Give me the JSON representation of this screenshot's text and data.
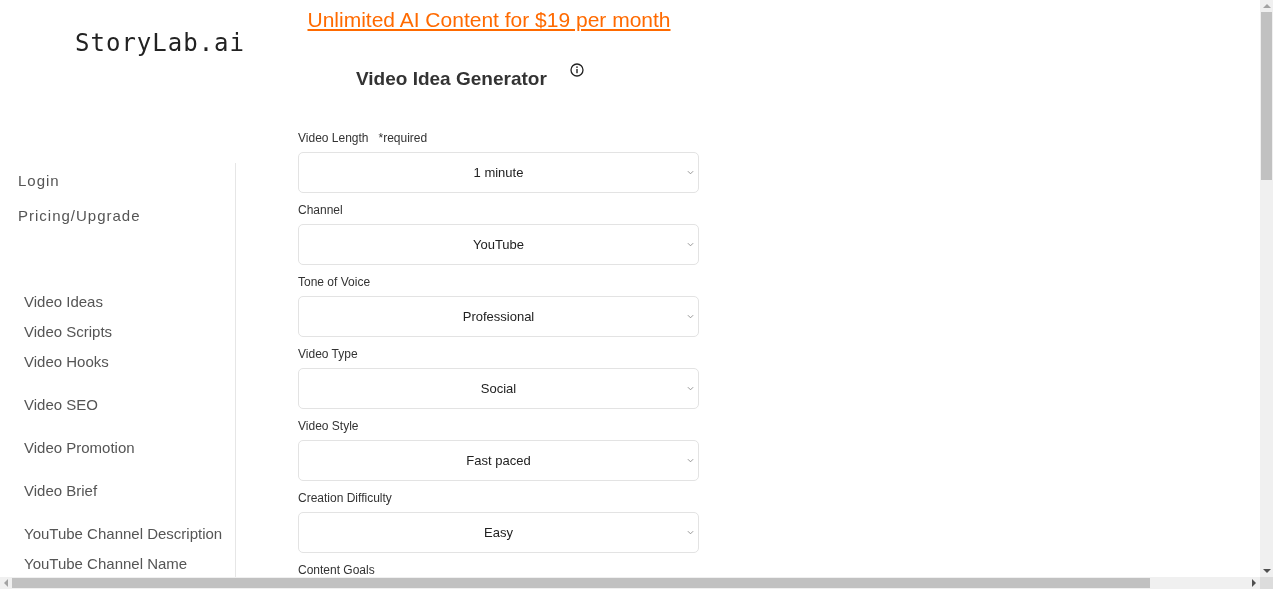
{
  "logo": "StoryLab.ai",
  "promo_link": "Unlimited AI Content for $19 per month",
  "title": "Video Idea Generator",
  "account_links": [
    "Login",
    "Pricing/Upgrade"
  ],
  "tool_groups": [
    {
      "items": [
        "Video Ideas",
        "Video Scripts",
        "Video Hooks"
      ]
    },
    {
      "items": [
        "Video SEO"
      ]
    },
    {
      "items": [
        "Video Promotion"
      ]
    },
    {
      "items": [
        "Video Brief"
      ]
    },
    {
      "items": [
        "YouTube Channel Description",
        "YouTube Channel Name"
      ]
    }
  ],
  "form": {
    "fields": [
      {
        "label": "Video Length",
        "note": "*required",
        "value": "1 minute"
      },
      {
        "label": "Channel",
        "value": "YouTube"
      },
      {
        "label": "Tone of Voice",
        "value": "Professional"
      },
      {
        "label": "Video Type",
        "value": "Social"
      },
      {
        "label": "Video Style",
        "value": "Fast paced"
      },
      {
        "label": "Creation Difficulty",
        "value": "Easy"
      },
      {
        "label": "Content Goals"
      }
    ]
  }
}
